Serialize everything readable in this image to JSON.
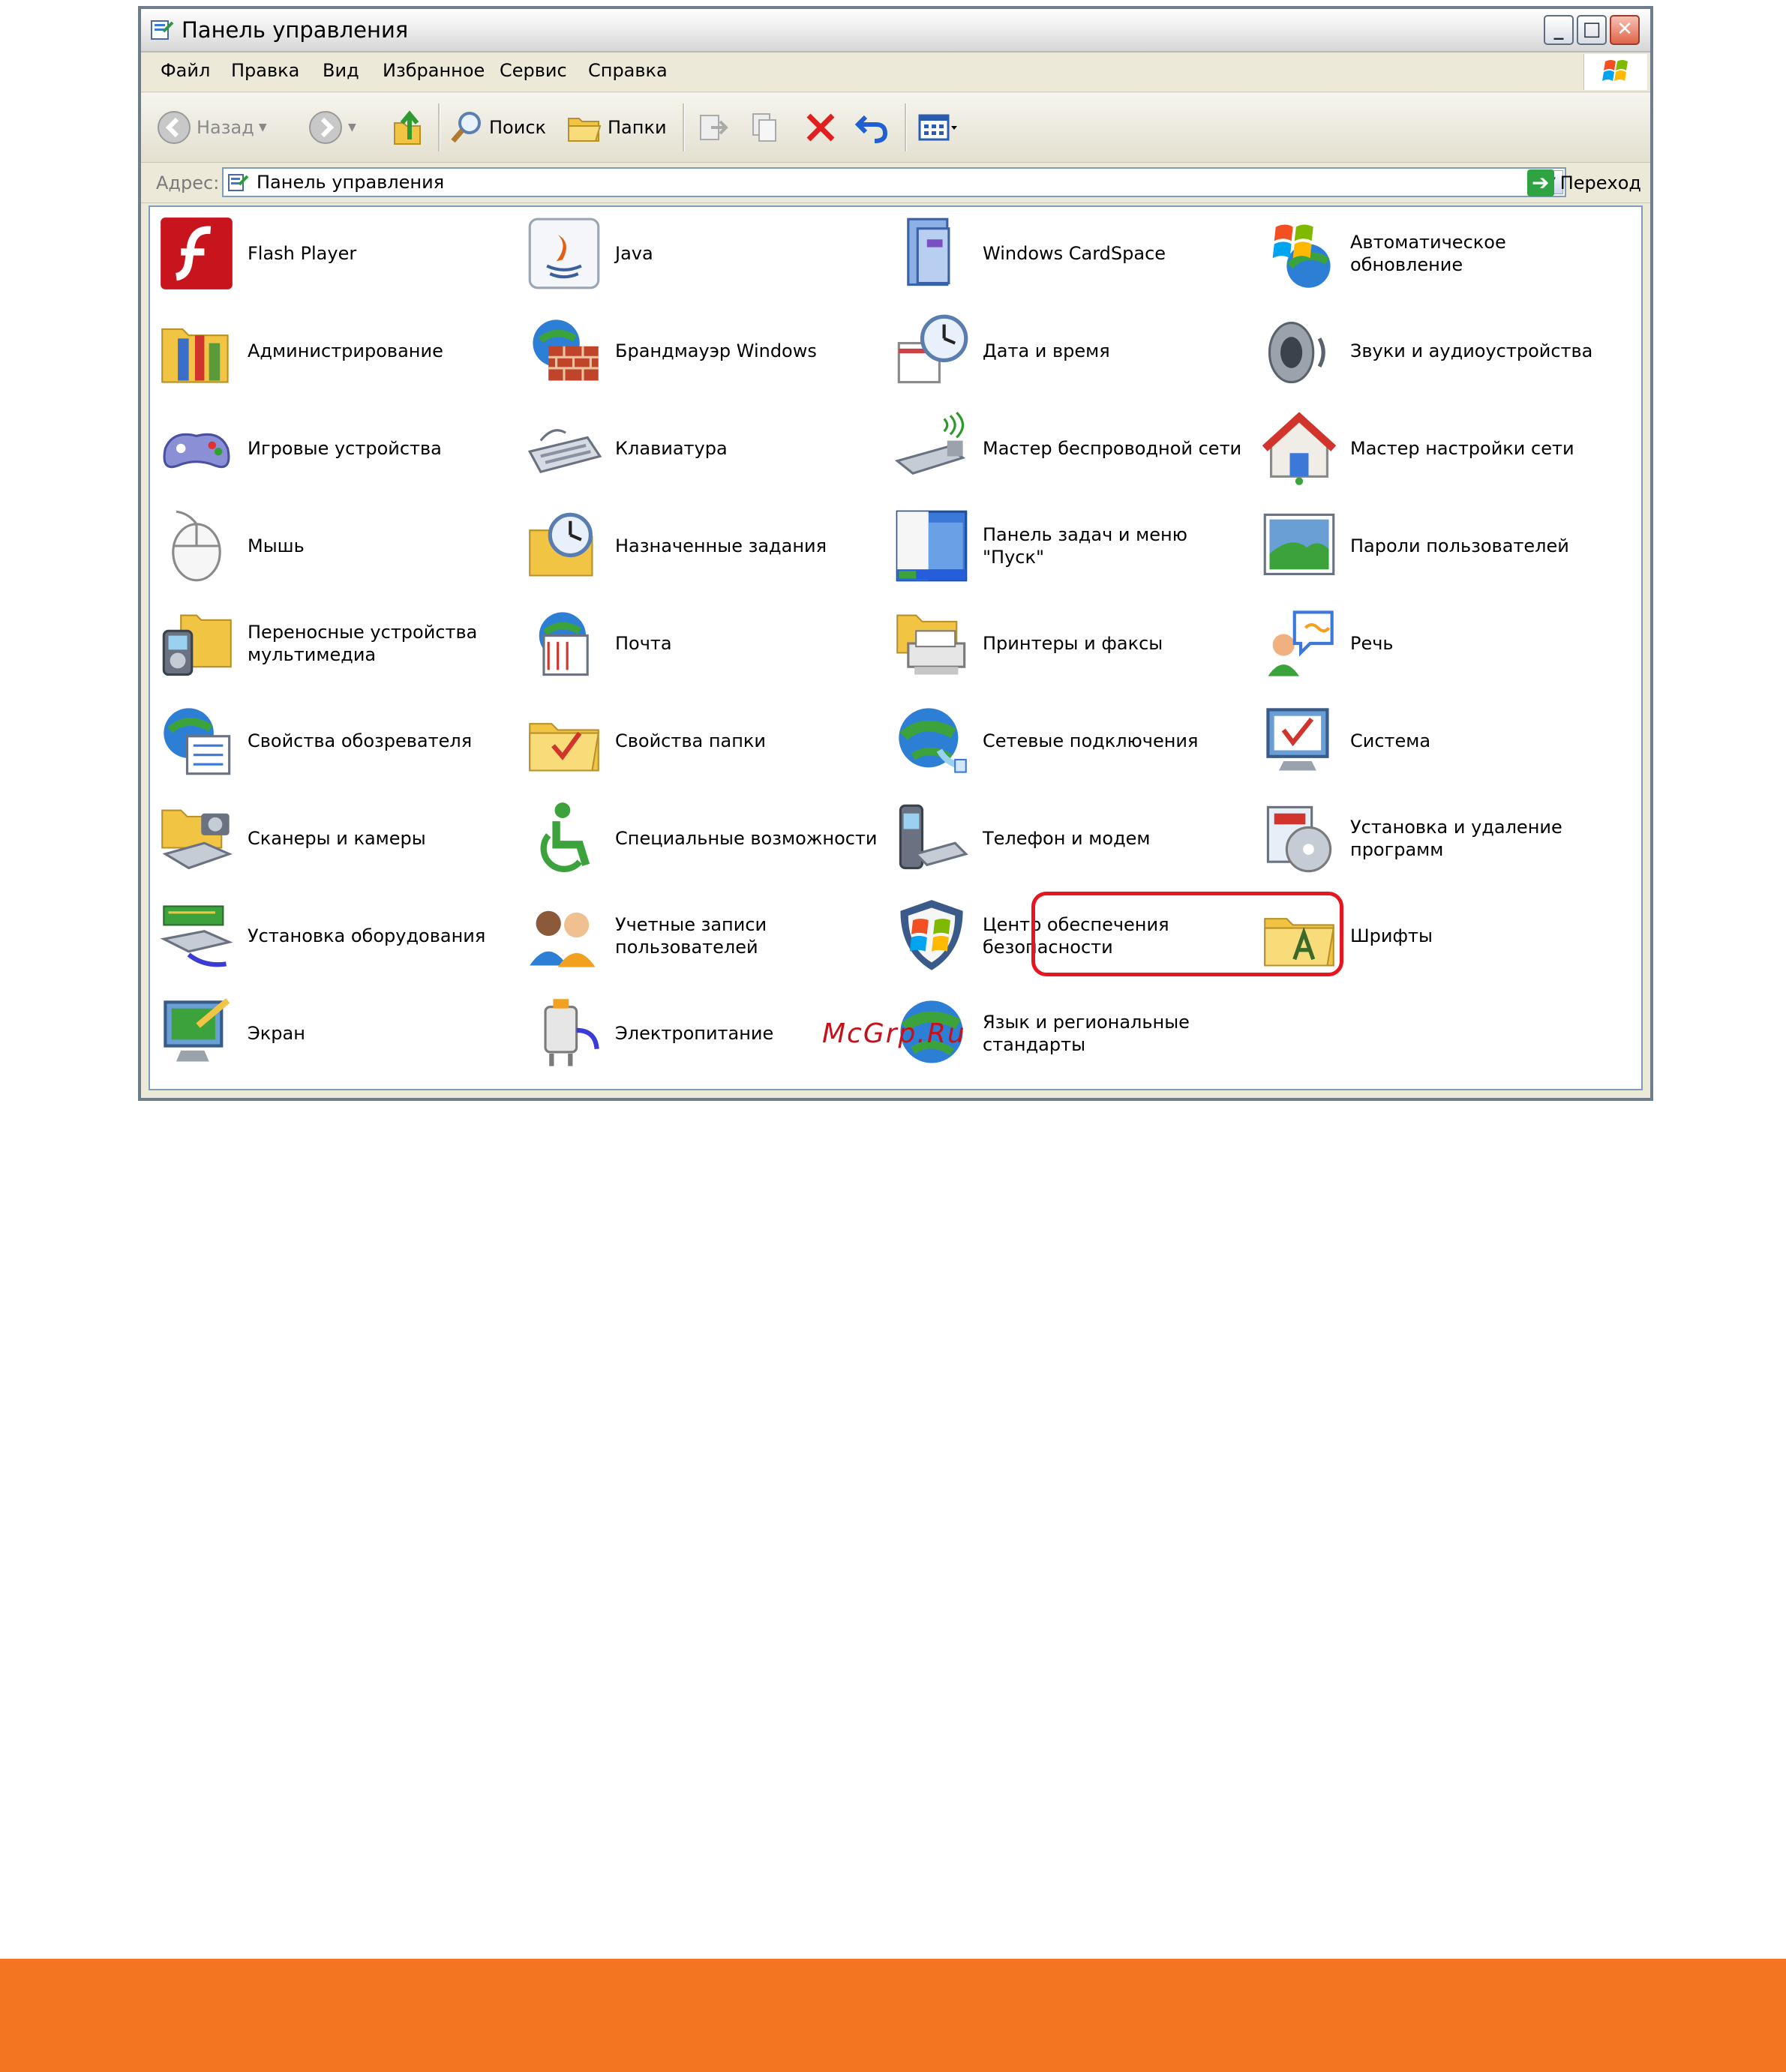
{
  "window": {
    "title": "Панель управления",
    "buttons": {
      "minimize": "_",
      "maximize": "□",
      "close": "✕"
    }
  },
  "menu": [
    "Файл",
    "Правка",
    "Вид",
    "Избранное",
    "Сервис",
    "Справка"
  ],
  "toolbar": {
    "back_label": "Назад",
    "search_label": "Поиск",
    "folders_label": "Папки"
  },
  "address": {
    "label": "Адрес:",
    "value": "Панель управления",
    "go_label": "Переход"
  },
  "items": [
    {
      "label": "Flash Player",
      "icon": "flash-icon"
    },
    {
      "label": "Java",
      "icon": "java-icon"
    },
    {
      "label": "Windows CardSpace",
      "icon": "cardspace-icon"
    },
    {
      "label": "Автоматическое обновление",
      "icon": "windows-update-icon"
    },
    {
      "label": "Администрирование",
      "icon": "admin-tools-icon"
    },
    {
      "label": "Брандмауэр Windows",
      "icon": "firewall-icon"
    },
    {
      "label": "Дата и время",
      "icon": "clock-icon"
    },
    {
      "label": "Звуки и аудиоустройства",
      "icon": "speaker-icon"
    },
    {
      "label": "Игровые устройства",
      "icon": "gamepad-icon"
    },
    {
      "label": "Клавиатура",
      "icon": "keyboard-icon"
    },
    {
      "label": "Мастер беспроводной сети",
      "icon": "wireless-icon"
    },
    {
      "label": "Мастер настройки сети",
      "icon": "home-network-icon"
    },
    {
      "label": "Мышь",
      "icon": "mouse-icon"
    },
    {
      "label": "Назначенные задания",
      "icon": "scheduled-tasks-icon"
    },
    {
      "label": "Панель задач и меню \"Пуск\"",
      "icon": "taskbar-icon"
    },
    {
      "label": "Пароли пользователей",
      "icon": "user-passwords-icon"
    },
    {
      "label": "Переносные устройства мультимедиа",
      "icon": "portable-media-icon"
    },
    {
      "label": "Почта",
      "icon": "mail-icon"
    },
    {
      "label": "Принтеры и факсы",
      "icon": "printer-icon"
    },
    {
      "label": "Речь",
      "icon": "speech-icon"
    },
    {
      "label": "Свойства обозревателя",
      "icon": "internet-options-icon"
    },
    {
      "label": "Свойства папки",
      "icon": "folder-options-icon"
    },
    {
      "label": "Сетевые подключения",
      "icon": "network-connections-icon"
    },
    {
      "label": "Система",
      "icon": "system-icon"
    },
    {
      "label": "Сканеры и камеры",
      "icon": "scanner-camera-icon"
    },
    {
      "label": "Специальные возможности",
      "icon": "accessibility-icon"
    },
    {
      "label": "Телефон и модем",
      "icon": "phone-modem-icon"
    },
    {
      "label": "Установка и удаление программ",
      "icon": "add-remove-programs-icon"
    },
    {
      "label": "Установка оборудования",
      "icon": "add-hardware-icon"
    },
    {
      "label": "Учетные записи пользователей",
      "icon": "user-accounts-icon"
    },
    {
      "label": "Центр обеспечения безопасности",
      "icon": "security-center-icon"
    },
    {
      "label": "Шрифты",
      "icon": "fonts-icon"
    },
    {
      "label": "Экран",
      "icon": "display-icon"
    },
    {
      "label": "Электропитание",
      "icon": "power-icon"
    },
    {
      "label": "Язык и региональные стандарты",
      "icon": "regional-icon"
    }
  ],
  "watermark": "McGrp.Ru",
  "colors": {
    "highlight": "#e8141e",
    "footer": "#f37421"
  }
}
